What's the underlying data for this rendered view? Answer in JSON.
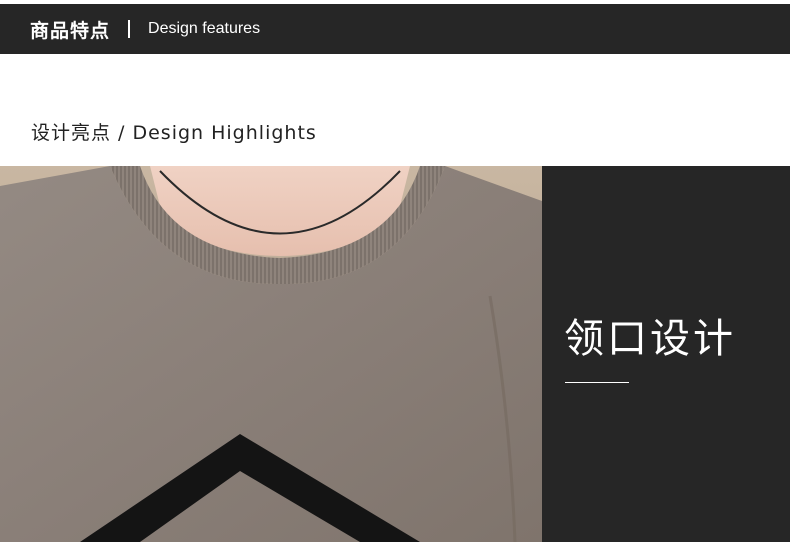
{
  "header": {
    "title_cn": "商品特点",
    "title_en": "Design features"
  },
  "section": {
    "subtitle": "设计亮点 / Design Highlights"
  },
  "feature": {
    "title": "领口设计"
  },
  "colors": {
    "dark": "#262626",
    "sweater": "#8a7f77",
    "pattern": "#141414"
  }
}
